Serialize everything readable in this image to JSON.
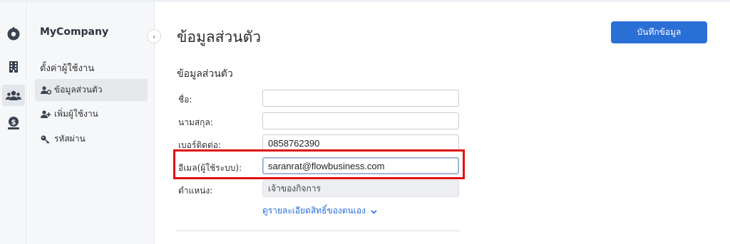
{
  "sidebar": {
    "company": "MyCompany",
    "section": "ตั้งค่าผู้ใช้งาน",
    "items": [
      {
        "label": "ข้อมูลส่วนตัว",
        "icon": "user-cog-icon",
        "active": true
      },
      {
        "label": "เพิ่มผู้ใช้งาน",
        "icon": "user-plus-icon",
        "active": false
      },
      {
        "label": "รหัสผ่าน",
        "icon": "key-icon",
        "active": false
      }
    ]
  },
  "rail": {
    "icons": [
      "settings-gear-icon",
      "building-icon",
      "users-group-icon",
      "money-icon"
    ]
  },
  "main": {
    "title": "ข้อมูลส่วนตัว",
    "save_label": "บันทึกข้อมูล",
    "section_title": "ข้อมูลส่วนตัว",
    "fields": [
      {
        "label": "ชื่อ:",
        "value": ""
      },
      {
        "label": "นามสกุล:",
        "value": ""
      },
      {
        "label": "เบอร์ติดต่อ:",
        "value": "0858762390"
      },
      {
        "label": "อีเมล(ผู้ใช้ระบบ):",
        "value": "saranrat@flowbusiness.com"
      },
      {
        "label": "ตำแหน่ง:",
        "value": "เจ้าของกิจการ"
      }
    ],
    "permissions_link": "ดูรายละเอียดสิทธิ์ของตนเอง"
  },
  "colors": {
    "accent": "#2a6fd6",
    "highlight": "#e01010",
    "sidebar_bg": "#f6f7f9"
  }
}
